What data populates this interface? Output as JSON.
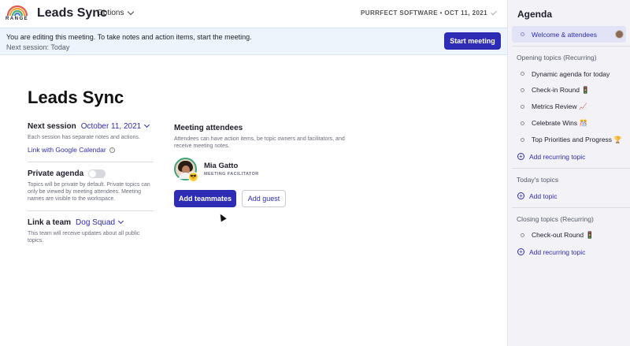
{
  "app": {
    "logo_text": "RANGE",
    "title": "Leads Sync",
    "options_label": "Options",
    "org_date": "PURRFECT SOFTWARE • OCT 11, 2021"
  },
  "banner": {
    "message": "You are editing this meeting. To take notes and action items, start the meeting.",
    "next_session": "Next session: Today",
    "start_button": "Start meeting"
  },
  "meeting": {
    "title": "Leads Sync",
    "next_session_label": "Next session",
    "next_session_value": "October 11, 2021",
    "next_session_desc": "Each session has separate notes and actions.",
    "gcal_link": "Link with Google Calendar",
    "private_label": "Private agenda",
    "private_desc": "Topics will be private by default. Private topics can only be viewed by meeting attendees. Meeting names are visible to the workspace.",
    "team_label": "Link a team",
    "team_value": "Dog Squad",
    "team_desc": "This team will receive updates about all public topics."
  },
  "attendees": {
    "heading": "Meeting attendees",
    "desc": "Attendees can have action items, be topic owners and facilitators, and receive meeting notes.",
    "people": [
      {
        "name": "Mia Gatto",
        "role": "MEETING FACILITATOR",
        "emoji": "😎"
      }
    ],
    "add_teammates": "Add teammates",
    "add_guest": "Add guest"
  },
  "agenda": {
    "title": "Agenda",
    "welcome": "Welcome & attendees",
    "opening_label": "Opening topics (Recurring)",
    "opening_items": [
      "Dynamic agenda for today",
      "Check-in Round 🚦",
      "Metrics Review 📈",
      "Celebrate Wins 🎊",
      "Top Priorities and Progress 🏆"
    ],
    "add_recurring": "Add recurring topic",
    "today_label": "Today's topics",
    "add_topic": "Add topic",
    "closing_label": "Closing topics (Recurring)",
    "closing_items": [
      "Check-out Round 🚦"
    ],
    "add_recurring_closing": "Add recurring topic"
  },
  "colors": {
    "accent": "#2e2cb5",
    "banner_bg": "#eef4fc",
    "sidebar_bg": "#f3f3f7",
    "active_item_bg": "#e3e3f8"
  }
}
